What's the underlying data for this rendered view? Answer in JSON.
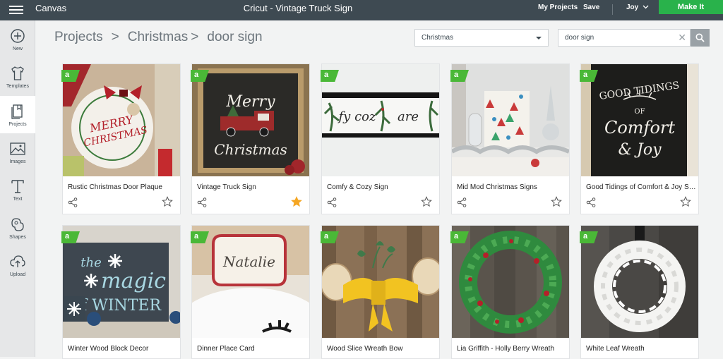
{
  "topbar": {
    "app_name": "Canvas",
    "doc_title": "Cricut - Vintage Truck Sign",
    "my_projects": "My Projects",
    "save": "Save",
    "user": "Joy",
    "make_it": "Make It"
  },
  "sidebar": {
    "items": [
      {
        "label": "New",
        "icon": "plus-circle-icon"
      },
      {
        "label": "Templates",
        "icon": "tshirt-icon"
      },
      {
        "label": "Projects",
        "icon": "projects-icon",
        "active": true
      },
      {
        "label": "Images",
        "icon": "image-icon"
      },
      {
        "label": "Text",
        "icon": "text-icon"
      },
      {
        "label": "Shapes",
        "icon": "shapes-icon"
      },
      {
        "label": "Upload",
        "icon": "upload-icon"
      }
    ]
  },
  "breadcrumb": {
    "root": "Projects",
    "sep1": ">",
    "category": "Christmas",
    "sep2": ">",
    "current": "door sign"
  },
  "filter": {
    "selected": "Christmas"
  },
  "search": {
    "value": "door sign"
  },
  "colors": {
    "accent_green": "#29b24b",
    "topbar": "#3e4a52",
    "favorite": "#f5a623"
  },
  "projects": [
    {
      "title": "Rustic Christmas Door Plaque",
      "favorite": false
    },
    {
      "title": "Vintage Truck Sign",
      "favorite": true
    },
    {
      "title": "Comfy & Cozy Sign",
      "favorite": false
    },
    {
      "title": "Mid Mod Christmas Signs",
      "favorite": false
    },
    {
      "title": "Good Tidings of Comfort & Joy Sign",
      "favorite": false
    },
    {
      "title": "Winter Wood Block Decor",
      "favorite": false
    },
    {
      "title": "Dinner Place Card",
      "favorite": false
    },
    {
      "title": "Wood Slice Wreath Bow",
      "favorite": false
    },
    {
      "title": "Lia Griffith - Holly Berry Wreath",
      "favorite": false
    },
    {
      "title": "White Leaf Wreath",
      "favorite": false
    }
  ],
  "artwork": {
    "plaque": [
      "MERRY",
      "CHRISTMAS"
    ],
    "truck": [
      "Merry",
      "Christmas"
    ],
    "comfy": [
      "fy coz",
      "are"
    ],
    "tidings": [
      "GOOD TIDINGS",
      "OF",
      "Comfort",
      "& Joy"
    ],
    "winter": [
      "the",
      "magic",
      "of WINTER"
    ],
    "place_card": [
      "Natalie"
    ],
    "badge_letter": "a"
  }
}
